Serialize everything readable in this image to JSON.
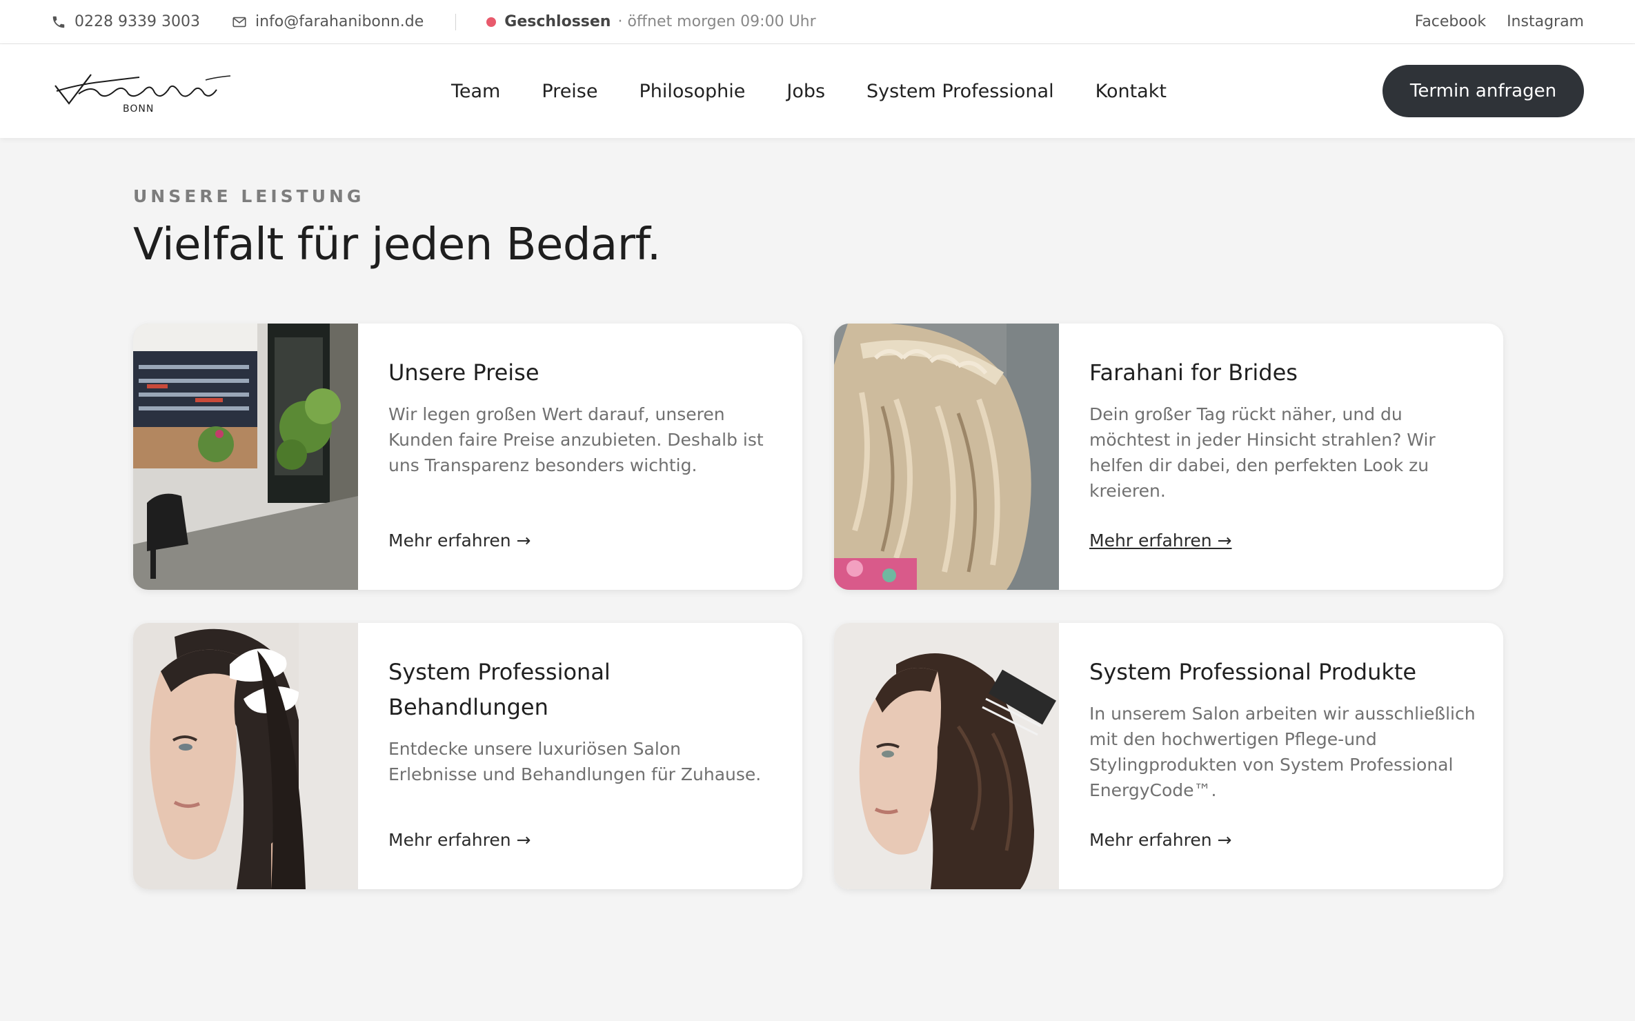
{
  "topbar": {
    "phone": "0228 9339 3003",
    "email": "info@farahanibonn.de",
    "status_label": "Geschlossen",
    "status_detail": "· öffnet morgen 09:00 Uhr",
    "status_color": "#e85a6c",
    "social": [
      {
        "label": "Facebook"
      },
      {
        "label": "Instagram"
      }
    ]
  },
  "header": {
    "logo_text": "Farahani",
    "logo_sub": "BONN",
    "nav": [
      {
        "label": "Team"
      },
      {
        "label": "Preise"
      },
      {
        "label": "Philosophie"
      },
      {
        "label": "Jobs"
      },
      {
        "label": "System Professional"
      },
      {
        "label": "Kontakt"
      }
    ],
    "cta_label": "Termin anfragen",
    "cta_color": "#2f3338"
  },
  "section": {
    "eyebrow": "UNSERE LEISTUNG",
    "title": "Vielfalt für jeden Bedarf."
  },
  "cards": [
    {
      "title": "Unsere Preise",
      "text": "Wir legen großen Wert darauf, unseren Kunden faire Preise anzubieten. Deshalb ist uns Transparenz besonders wichtig.",
      "link": "Mehr erfahren →",
      "image_icon": "salon-interior-image"
    },
    {
      "title": "Farahani for Brides",
      "text": "Dein großer Tag rückt näher, und du möchtest in jeder Hinsicht strahlen? Wir helfen dir dabei, den perfekten Look zu kreieren.",
      "link": "Mehr erfahren →",
      "image_icon": "bridal-braid-image"
    },
    {
      "title": "System Professional Behandlungen",
      "text": "Entdecke unsere luxuriösen Salon Erlebnisse und Behandlungen für Zuhause.",
      "link": "Mehr erfahren →",
      "image_icon": "hair-treatment-image"
    },
    {
      "title": "System Professional Produkte",
      "text": "In unserem Salon arbeiten wir ausschließlich mit den hochwertigen Pflege-und Stylingprodukten von System Professional EnergyCode™.",
      "link": "Mehr erfahren →",
      "image_icon": "hair-coloring-image"
    }
  ]
}
